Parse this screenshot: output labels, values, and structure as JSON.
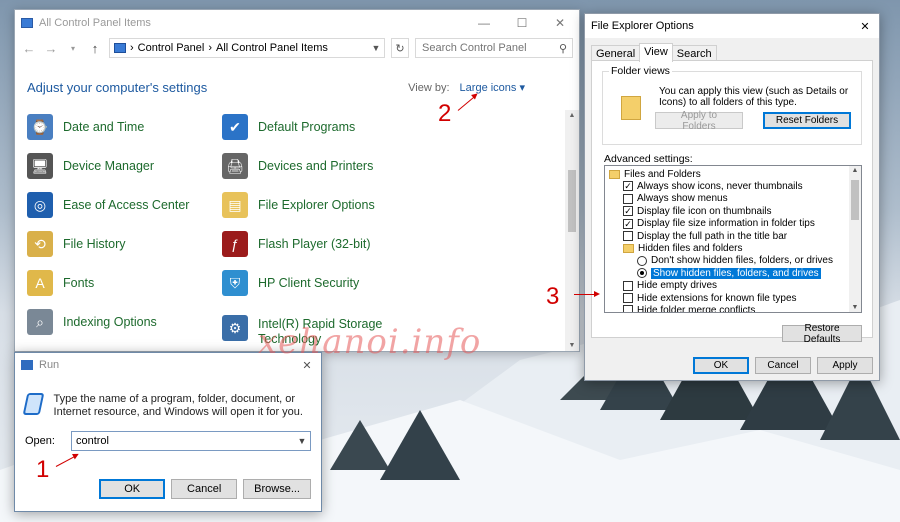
{
  "control_panel": {
    "window_title": "All Control Panel Items",
    "breadcrumb": [
      "Control Panel",
      "All Control Panel Items"
    ],
    "search_placeholder": "Search Control Panel",
    "heading": "Adjust your computer's settings",
    "view_by_label": "View by:",
    "view_by_value": "Large icons",
    "items": [
      {
        "label": "Date and Time",
        "icon": "calendar-clock-icon",
        "color": "#4a7fc1"
      },
      {
        "label": "Default Programs",
        "icon": "default-programs-icon",
        "color": "#2b73c7"
      },
      {
        "label": "Device Manager",
        "icon": "device-manager-icon",
        "color": "#555555"
      },
      {
        "label": "Devices and Printers",
        "icon": "printer-icon",
        "color": "#666666"
      },
      {
        "label": "Ease of Access Center",
        "icon": "ease-of-access-icon",
        "color": "#1f5fae"
      },
      {
        "label": "File Explorer Options",
        "icon": "folder-options-icon",
        "color": "#e8c25a"
      },
      {
        "label": "File History",
        "icon": "file-history-icon",
        "color": "#d9b04a"
      },
      {
        "label": "Flash Player (32-bit)",
        "icon": "flash-player-icon",
        "color": "#9b1b1b"
      },
      {
        "label": "Fonts",
        "icon": "fonts-icon",
        "color": "#e0b84a"
      },
      {
        "label": "HP Client Security",
        "icon": "hp-security-icon",
        "color": "#2f8fd0"
      },
      {
        "label": "Indexing Options",
        "icon": "indexing-icon",
        "color": "#7a8896"
      },
      {
        "label": "Intel(R) Rapid Storage Technology",
        "icon": "intel-storage-icon",
        "color": "#3a6ea8"
      }
    ]
  },
  "run_dialog": {
    "title": "Run",
    "description": "Type the name of a program, folder, document, or Internet resource, and Windows will open it for you.",
    "open_label": "Open:",
    "open_value": "control",
    "buttons": {
      "ok": "OK",
      "cancel": "Cancel",
      "browse": "Browse..."
    }
  },
  "feo": {
    "title": "File Explorer Options",
    "tabs": [
      "General",
      "View",
      "Search"
    ],
    "active_tab": "View",
    "folder_views_label": "Folder views",
    "folder_views_text": "You can apply this view (such as Details or Icons) to all folders of this type.",
    "apply_to_folders": "Apply to Folders",
    "reset_folders": "Reset Folders",
    "advanced_label": "Advanced settings:",
    "advanced_items": [
      {
        "type": "folder",
        "label": "Files and Folders",
        "indent": 0
      },
      {
        "type": "check",
        "label": "Always show icons, never thumbnails",
        "checked": true,
        "indent": 1
      },
      {
        "type": "check",
        "label": "Always show menus",
        "checked": false,
        "indent": 1
      },
      {
        "type": "check",
        "label": "Display file icon on thumbnails",
        "checked": true,
        "indent": 1
      },
      {
        "type": "check",
        "label": "Display file size information in folder tips",
        "checked": true,
        "indent": 1
      },
      {
        "type": "check",
        "label": "Display the full path in the title bar",
        "checked": false,
        "indent": 1
      },
      {
        "type": "folder",
        "label": "Hidden files and folders",
        "indent": 1
      },
      {
        "type": "radio",
        "label": "Don't show hidden files, folders, or drives",
        "checked": false,
        "indent": 2
      },
      {
        "type": "radio",
        "label": "Show hidden files, folders, and drives",
        "checked": true,
        "selected": true,
        "indent": 2
      },
      {
        "type": "check",
        "label": "Hide empty drives",
        "checked": false,
        "indent": 1
      },
      {
        "type": "check",
        "label": "Hide extensions for known file types",
        "checked": false,
        "indent": 1
      },
      {
        "type": "check",
        "label": "Hide folder merge conflicts",
        "checked": false,
        "indent": 1
      }
    ],
    "restore_defaults": "Restore Defaults",
    "buttons": {
      "ok": "OK",
      "cancel": "Cancel",
      "apply": "Apply"
    }
  },
  "annotations": {
    "one": "1",
    "two": "2",
    "three": "3"
  },
  "watermark": "xehanoi.info"
}
